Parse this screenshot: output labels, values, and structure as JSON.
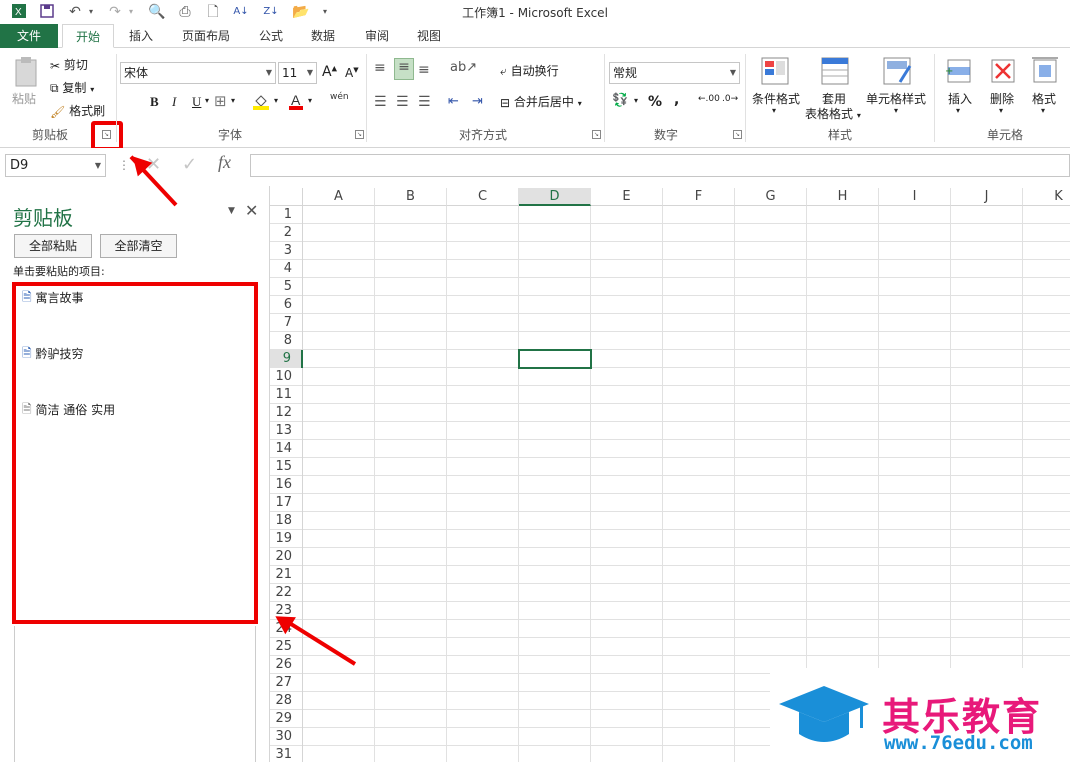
{
  "title": "工作簿1 - Microsoft Excel",
  "tabs": [
    "文件",
    "开始",
    "插入",
    "页面布局",
    "公式",
    "数据",
    "审阅",
    "视图"
  ],
  "clipboard_group": {
    "paste": "粘贴",
    "cut": "剪切",
    "copy": "复制",
    "format_painter": "格式刷",
    "label": "剪贴板"
  },
  "font_group": {
    "font_name": "宋体",
    "font_size": "11",
    "bold": "B",
    "italic": "I",
    "underline": "U",
    "inc_font": "A",
    "dec_font": "A",
    "label": "字体",
    "phonetic": "wén"
  },
  "align_group": {
    "wrap": "自动换行",
    "merge": "合并后居中",
    "label": "对齐方式"
  },
  "number_group": {
    "format": "常规",
    "percent": "%",
    "comma": ",",
    "inc_dec": ".00",
    "dec_dec": ".0",
    "label": "数字"
  },
  "styles_group": {
    "conditional": "条件格式",
    "table_line1": "套用",
    "table_line2": "表格格式",
    "cell_styles": "单元格样式",
    "label": "样式"
  },
  "cells_group": {
    "insert": "插入",
    "delete": "删除",
    "format": "格式",
    "label": "单元格"
  },
  "name_box": "D9",
  "fx": "fx",
  "pane": {
    "title": "剪贴板",
    "paste_all": "全部粘贴",
    "clear_all": "全部清空",
    "hint": "单击要粘贴的项目:",
    "items": [
      "寓言故事",
      "黔驴技穷",
      "简洁 通俗 实用"
    ]
  },
  "columns": [
    "A",
    "B",
    "C",
    "D",
    "E",
    "F",
    "G",
    "H",
    "I",
    "J",
    "K"
  ],
  "rows": [
    "1",
    "2",
    "3",
    "4",
    "5",
    "6",
    "7",
    "8",
    "9",
    "10",
    "11",
    "12",
    "13",
    "14",
    "15",
    "16",
    "17",
    "18",
    "19",
    "20",
    "21",
    "22",
    "23",
    "24",
    "25",
    "26",
    "27",
    "28",
    "29",
    "30",
    "31"
  ],
  "selected_cell": "D9",
  "watermark": {
    "brand": "其乐教育",
    "url": "www.76edu.com"
  },
  "colors": {
    "accent": "#217346",
    "highlight": "#e00000",
    "watermark_blue": "#1a8fd8",
    "watermark_pink": "#e8197a"
  }
}
